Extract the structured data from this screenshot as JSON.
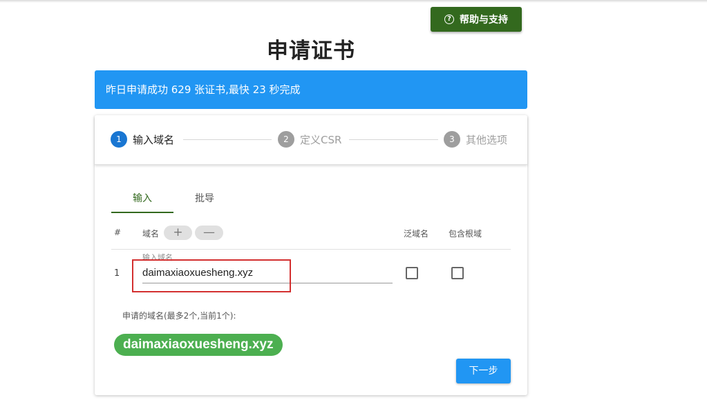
{
  "help_button": {
    "label": "帮助与支持",
    "icon": "question-circle-icon"
  },
  "title": "申请证书",
  "banner": {
    "text": "昨日申请成功 629 张证书,最快 23 秒完成",
    "color": "#2196f3"
  },
  "stepper": {
    "steps": [
      {
        "number": "1",
        "label": "输入域名",
        "state": "active"
      },
      {
        "number": "2",
        "label": "定义CSR",
        "state": "inactive"
      },
      {
        "number": "3",
        "label": "其他选项",
        "state": "inactive"
      }
    ]
  },
  "tabs": [
    {
      "label": "输入",
      "active": true
    },
    {
      "label": "批导",
      "active": false
    }
  ],
  "table": {
    "headers": {
      "index": "#",
      "domain": "域名",
      "wildcard": "泛域名",
      "include_root": "包含根域"
    },
    "add_symbol": "+",
    "remove_symbol": "—",
    "rows": [
      {
        "index": "1",
        "input_label": "输入域名",
        "value": "daimaxiaoxuesheng.xyz",
        "wildcard": false,
        "include_root": false
      }
    ]
  },
  "applied": {
    "label": "申请的域名(最多2个,当前1个):",
    "domains": [
      "daimaxiaoxuesheng.xyz"
    ]
  },
  "next_button": {
    "label": "下一步"
  },
  "colors": {
    "help_button": "#33691e",
    "accent_blue": "#2196f3",
    "step_active": "#1976d2",
    "tab_active": "#33691e",
    "chip": "#4caf50",
    "highlight": "#d32f2f"
  }
}
